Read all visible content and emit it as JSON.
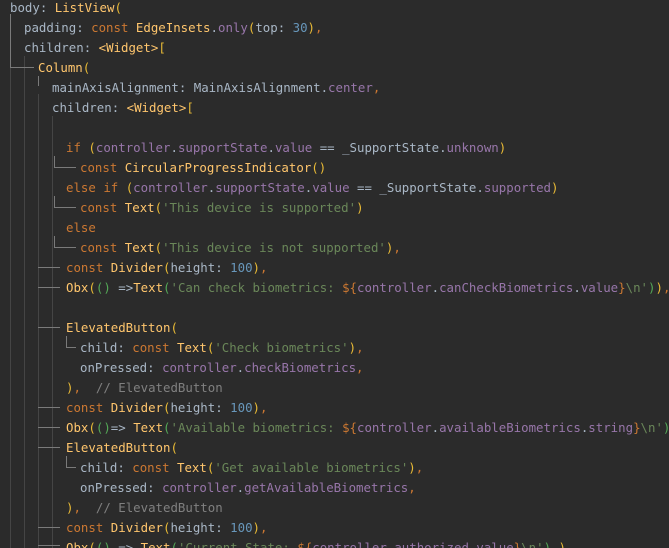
{
  "editor": {
    "code_lines": [
      "body: ListView(",
      "padding: const EdgeInsets.only(top: 30),",
      "children: <Widget>[",
      "Column(",
      "mainAxisAlignment: MainAxisAlignment.center,",
      "children: <Widget>[",
      "",
      "if (controller.supportState.value == _SupportState.unknown)",
      "const CircularProgressIndicator()",
      "else if (controller.supportState.value == _SupportState.supported)",
      "const Text('This device is supported')",
      "else",
      "const Text('This device is not supported'),",
      "const Divider(height: 100),",
      "Obx(() =>Text('Can check biometrics: ${controller.canCheckBiometrics.value}\\n')),",
      "",
      "ElevatedButton(",
      "child: const Text('Check biometrics'),",
      "onPressed: controller.checkBiometrics,",
      "),  // ElevatedButton",
      "const Divider(height: 100),",
      "Obx(()=> Text('Available biometrics: ${controller.availableBiometrics.string}\\n')),",
      "ElevatedButton(",
      "child: const Text('Get available biometrics'),",
      "onPressed: controller.getAvailableBiometrics,",
      "),  // ElevatedButton",
      "const Divider(height: 100),",
      "Obx(() => Text('Current State: ${controller.authorized.value}\\n'),),"
    ]
  }
}
